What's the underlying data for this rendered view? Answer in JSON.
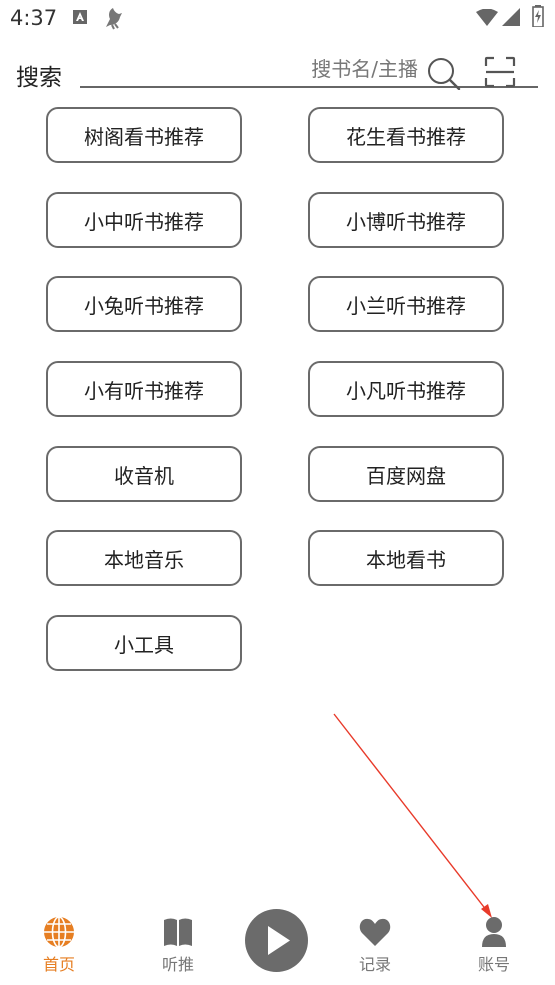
{
  "status_bar": {
    "time": "4:37"
  },
  "search": {
    "label": "搜索",
    "placeholder": "搜书名/主播"
  },
  "tiles": [
    "树阁看书推荐",
    "花生看书推荐",
    "小中听书推荐",
    "小博听书推荐",
    "小兔听书推荐",
    "小兰听书推荐",
    "小有听书推荐",
    "小凡听书推荐",
    "收音机",
    "百度网盘",
    "本地音乐",
    "本地看书",
    "小工具"
  ],
  "nav": {
    "home": "首页",
    "listen": "听推",
    "records": "记录",
    "account": "账号",
    "active": "home"
  },
  "colors": {
    "accent": "#e67e22",
    "annotation_arrow": "#e83a2a",
    "icon_gray": "#6b6b6b"
  }
}
